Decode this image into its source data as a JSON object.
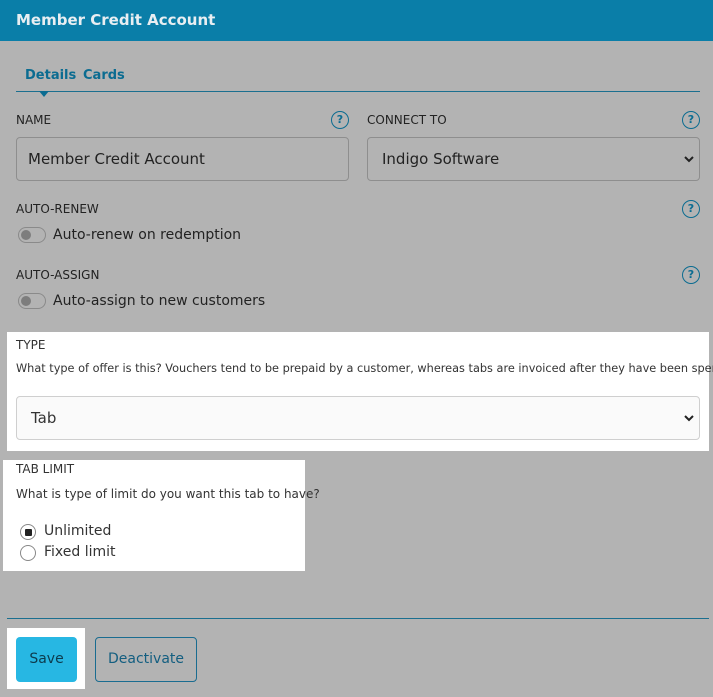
{
  "header": {
    "title": "Member Credit Account"
  },
  "tabs": [
    {
      "label": "Details"
    },
    {
      "label": "Cards"
    }
  ],
  "name": {
    "label": "NAME",
    "value": "Member Credit Account"
  },
  "connect_to": {
    "label": "CONNECT TO",
    "selected": "Indigo Software"
  },
  "auto_renew": {
    "label": "AUTO-RENEW",
    "toggle_label": "Auto-renew on redemption",
    "enabled": false
  },
  "auto_assign": {
    "label": "AUTO-ASSIGN",
    "toggle_label": "Auto-assign to new customers",
    "enabled": false
  },
  "type": {
    "label": "TYPE",
    "description": "What type of offer is this? Vouchers tend to be prepaid by a customer, whereas tabs are invoiced after they have been spent",
    "selected": "Tab"
  },
  "tab_limit": {
    "label": "TAB LIMIT",
    "description": "What is type of limit do you want this tab to have?",
    "options": [
      {
        "label": "Unlimited",
        "checked": true
      },
      {
        "label": "Fixed limit",
        "checked": false
      }
    ]
  },
  "help_icon_glyph": "?",
  "actions": {
    "save_label": "Save",
    "deactivate_label": "Deactivate"
  },
  "colors": {
    "header": "#0a7ea8",
    "accent": "#0b6c91",
    "save_button": "#27b7e3",
    "overlay": "#b3b3b3"
  }
}
